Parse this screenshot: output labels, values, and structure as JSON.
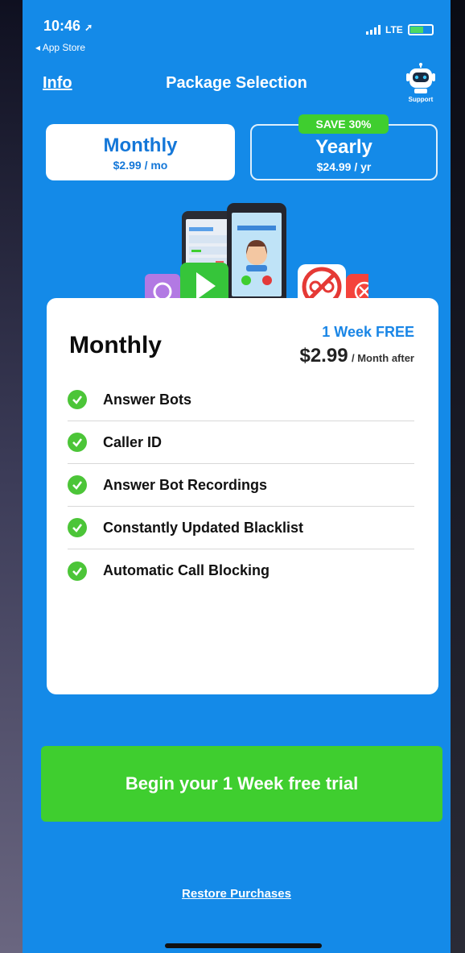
{
  "status": {
    "time": "10:46",
    "back_label": "◂ App Store",
    "network": "LTE"
  },
  "nav": {
    "info_label": "Info",
    "title": "Package Selection",
    "support_label": "Support"
  },
  "tabs": [
    {
      "name": "Monthly",
      "price": "$2.99 / mo",
      "selected": true
    },
    {
      "name": "Yearly",
      "price": "$24.99 / yr",
      "badge": "SAVE 30%",
      "selected": false
    }
  ],
  "card": {
    "title": "Monthly",
    "free_label": "1 Week FREE",
    "price_amount": "$2.99",
    "price_suffix": "/ Month after",
    "features": [
      "Answer Bots",
      "Caller ID",
      "Answer Bot Recordings",
      "Constantly Updated Blacklist",
      "Automatic Call Blocking"
    ]
  },
  "cta_label": "Begin your 1 Week free trial",
  "restore_label": "Restore Purchases",
  "colors": {
    "background": "#148ae8",
    "accent_green": "#3fce2f",
    "card": "#ffffff",
    "link_blue": "#1a86e6"
  }
}
